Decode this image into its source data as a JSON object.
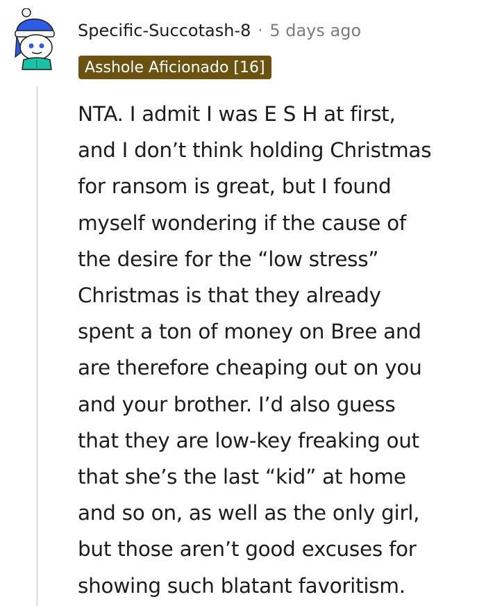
{
  "comment": {
    "author": "Specific-Succotash-8",
    "separator": "·",
    "time_ago": "5 days ago",
    "flair": "Asshole Aficionado [16]",
    "body_lines": [
      "NTA. I admit I was E S H at first,",
      "and I don’t think holding Christmas",
      "for ransom is great, but I found",
      "myself wondering if the cause of",
      "the desire for the “low stress”",
      "Christmas is that they already",
      "spent a ton of money on Bree and",
      "are therefore cheaping out on you",
      "and your brother. I’d also guess",
      "that they are low-key freaking out",
      "that she’s the last “kid” at home",
      "and so on, as well as the only girl,",
      "but those aren’t good excuses for",
      "showing such blatant favoritism."
    ]
  },
  "colors": {
    "flair_background": "#6b5211",
    "flair_text": "#ffffff",
    "meta_gray": "#7c7c7c",
    "text": "#1c1c1c",
    "thread_line": "#e4e6e8",
    "avatar_blue": "#2d5be3",
    "avatar_teal": "#19c2a6"
  },
  "icons": {
    "avatar": "snoo-avatar-with-beanie"
  }
}
